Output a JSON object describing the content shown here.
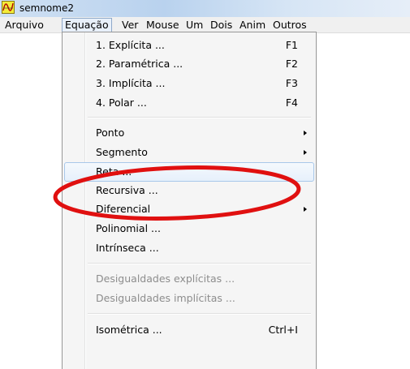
{
  "window": {
    "title": "semnome2",
    "icon": "graph-app-icon"
  },
  "menubar": {
    "items": [
      "Arquivo",
      "Equação",
      "Ver",
      "Mouse",
      "Um",
      "Dois",
      "Anim",
      "Outros"
    ],
    "active": "Equação"
  },
  "dropdown": {
    "items": [
      {
        "label": "1. Explícita ...",
        "shortcut": "F1"
      },
      {
        "label": "2. Paramétrica ...",
        "shortcut": "F2"
      },
      {
        "label": "3. Implícita ...",
        "shortcut": "F3"
      },
      {
        "label": "4. Polar ...",
        "shortcut": "F4"
      },
      {
        "label": "Ponto",
        "submenu": true
      },
      {
        "label": "Segmento",
        "submenu": true
      },
      {
        "label": "Reta ...",
        "highlighted": true
      },
      {
        "label": "Recursiva ..."
      },
      {
        "label": "Diferencial",
        "submenu": true
      },
      {
        "label": "Polinomial ..."
      },
      {
        "label": "Intrínseca ..."
      },
      {
        "label": "Desigualdades explícitas ...",
        "disabled": true
      },
      {
        "label": "Desigualdades implícitas ...",
        "disabled": true
      },
      {
        "label": "Isométrica ...",
        "shortcut": "Ctrl+I"
      }
    ]
  },
  "annotation": {
    "shape": "ellipse",
    "color": "#e01010",
    "encircles": "Reta ..."
  },
  "colors": {
    "menu_bg": "#f5f5f5",
    "highlight_border": "#a8c8ea",
    "disabled_text": "#8d8d8d",
    "annotation_red": "#e01010"
  }
}
